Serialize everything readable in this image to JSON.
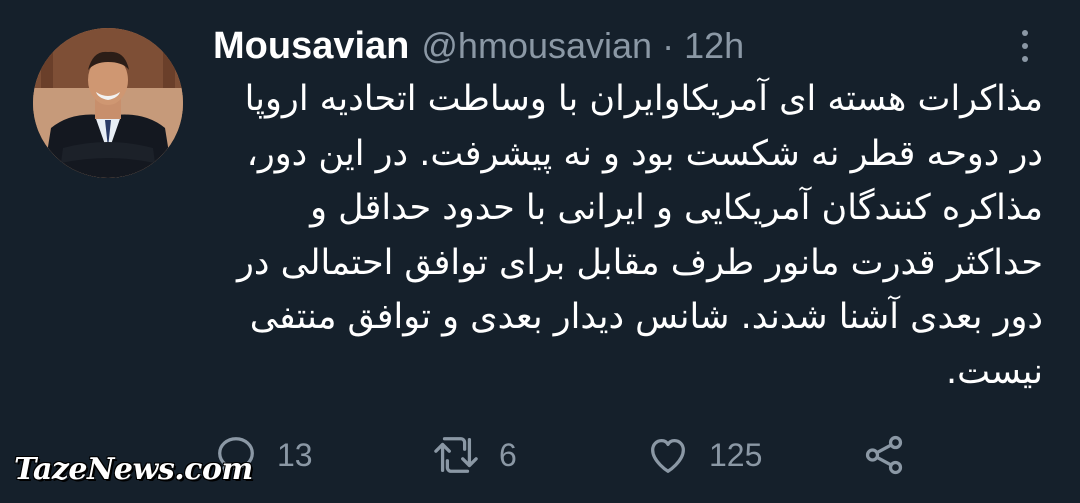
{
  "tweet": {
    "display_name": "Mousavian",
    "handle": "@hmousavian",
    "separator": "·",
    "time": "12h",
    "text_lines": [
      "مذاکرات هسته ای آمریکاوایران با وساطت اتحادیه اروپا",
      "در دوحه قطر نه شکست بود و نه پیشرفت. در این دور،",
      "مذاکره کنندگان آمریکایی و ایرانی با حدود حداقل و",
      "حداکثر قدرت مانور طرف مقابل برای توافق احتمالی در",
      "دور بعدی آشنا شدند. شانس دیدار بعدی و توافق منتفی",
      "نیست."
    ]
  },
  "actions": {
    "reply_icon": "reply-icon",
    "reply_count": "13",
    "retweet_icon": "retweet-icon",
    "retweet_count": "6",
    "like_icon": "heart-icon",
    "like_count": "125",
    "share_icon": "share-icon"
  },
  "watermark": "TazeNews.com",
  "colors": {
    "background": "#15202b",
    "primary_text": "#ffffff",
    "secondary_text": "#8b98a5"
  }
}
